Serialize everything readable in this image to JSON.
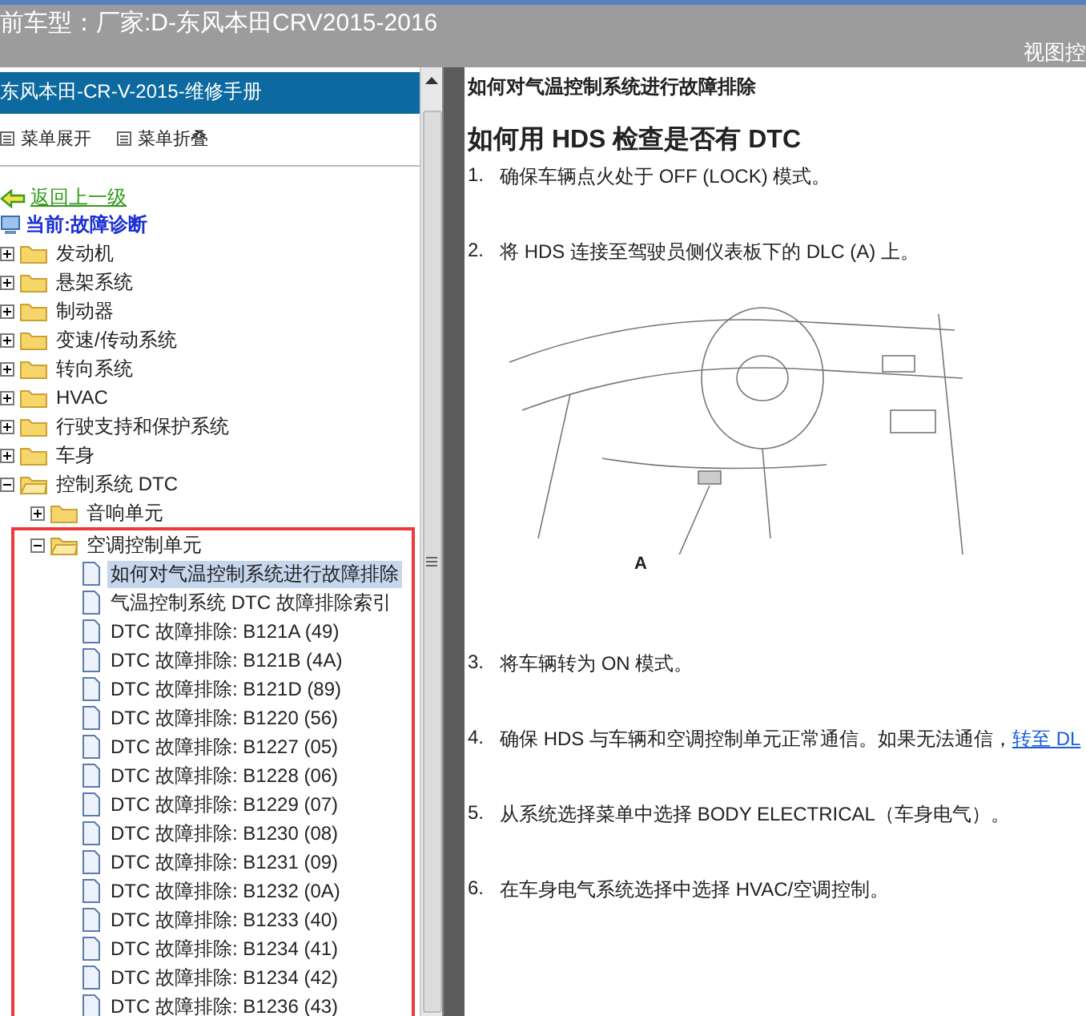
{
  "header": {
    "title": "前车型：厂家:D-东风本田CRV2015-2016",
    "right_label": "视图控"
  },
  "sidebar": {
    "title": "东风本田-CR-V-2015-维修手册",
    "actions": [
      {
        "label": "菜单展开"
      },
      {
        "label": "菜单折叠"
      }
    ],
    "back_link": "返回上一级",
    "current": "当前:故障诊断",
    "tree": [
      {
        "label": "发动机",
        "kind": "folder",
        "expanded": false
      },
      {
        "label": "悬架系统",
        "kind": "folder",
        "expanded": false
      },
      {
        "label": "制动器",
        "kind": "folder",
        "expanded": false
      },
      {
        "label": "变速/传动系统",
        "kind": "folder",
        "expanded": false
      },
      {
        "label": "转向系统",
        "kind": "folder",
        "expanded": false
      },
      {
        "label": "HVAC",
        "kind": "folder",
        "expanded": false
      },
      {
        "label": "行驶支持和保护系统",
        "kind": "folder",
        "expanded": false
      },
      {
        "label": "车身",
        "kind": "folder",
        "expanded": false
      },
      {
        "label": "控制系统 DTC",
        "kind": "folder",
        "expanded": true,
        "children": [
          {
            "label": "音响单元",
            "kind": "folder",
            "expanded": false
          },
          {
            "label": "空调控制单元",
            "kind": "folder",
            "expanded": true,
            "highlighted": true,
            "children": [
              {
                "label": "如何对气温控制系统进行故障排除",
                "kind": "doc",
                "selected": true
              },
              {
                "label": "气温控制系统 DTC 故障排除索引",
                "kind": "doc",
                "selected": false
              },
              {
                "label": "DTC 故障排除: B121A (49)",
                "kind": "doc",
                "selected": false
              },
              {
                "label": "DTC 故障排除: B121B (4A)",
                "kind": "doc",
                "selected": false
              },
              {
                "label": "DTC 故障排除: B121D (89)",
                "kind": "doc",
                "selected": false
              },
              {
                "label": "DTC 故障排除: B1220 (56)",
                "kind": "doc",
                "selected": false
              },
              {
                "label": "DTC 故障排除: B1227 (05)",
                "kind": "doc",
                "selected": false
              },
              {
                "label": "DTC 故障排除: B1228 (06)",
                "kind": "doc",
                "selected": false
              },
              {
                "label": "DTC 故障排除: B1229 (07)",
                "kind": "doc",
                "selected": false
              },
              {
                "label": "DTC 故障排除: B1230 (08)",
                "kind": "doc",
                "selected": false
              },
              {
                "label": "DTC 故障排除: B1231 (09)",
                "kind": "doc",
                "selected": false
              },
              {
                "label": "DTC 故障排除: B1232 (0A)",
                "kind": "doc",
                "selected": false
              },
              {
                "label": "DTC 故障排除: B1233 (40)",
                "kind": "doc",
                "selected": false
              },
              {
                "label": "DTC 故障排除: B1234 (41)",
                "kind": "doc",
                "selected": false
              },
              {
                "label": "DTC 故障排除: B1234 (42)",
                "kind": "doc",
                "selected": false
              },
              {
                "label": "DTC 故障排除: B1236 (43)",
                "kind": "doc",
                "selected": false
              }
            ]
          }
        ]
      }
    ]
  },
  "content": {
    "page_title": "如何对气温控制系统进行故障排除",
    "heading": "如何用 HDS 检查是否有 DTC",
    "steps": [
      {
        "number": "1.",
        "text": "确保车辆点火处于 OFF (LOCK) 模式。"
      },
      {
        "number": "2.",
        "text": "将 HDS 连接至驾驶员侧仪表板下的 DLC (A) 上。",
        "figure_label": "A"
      },
      {
        "number": "3.",
        "text": "将车辆转为 ON 模式。"
      },
      {
        "number": "4.",
        "text": "确保 HDS 与车辆和空调控制单元正常通信。如果无法通信，",
        "link": "转至 DL"
      },
      {
        "number": "5.",
        "text": "从系统选择菜单中选择 BODY ELECTRICAL（车身电气）。"
      },
      {
        "number": "6.",
        "text": "在车身电气系统选择中选择 HVAC/空调控制。"
      }
    ]
  }
}
